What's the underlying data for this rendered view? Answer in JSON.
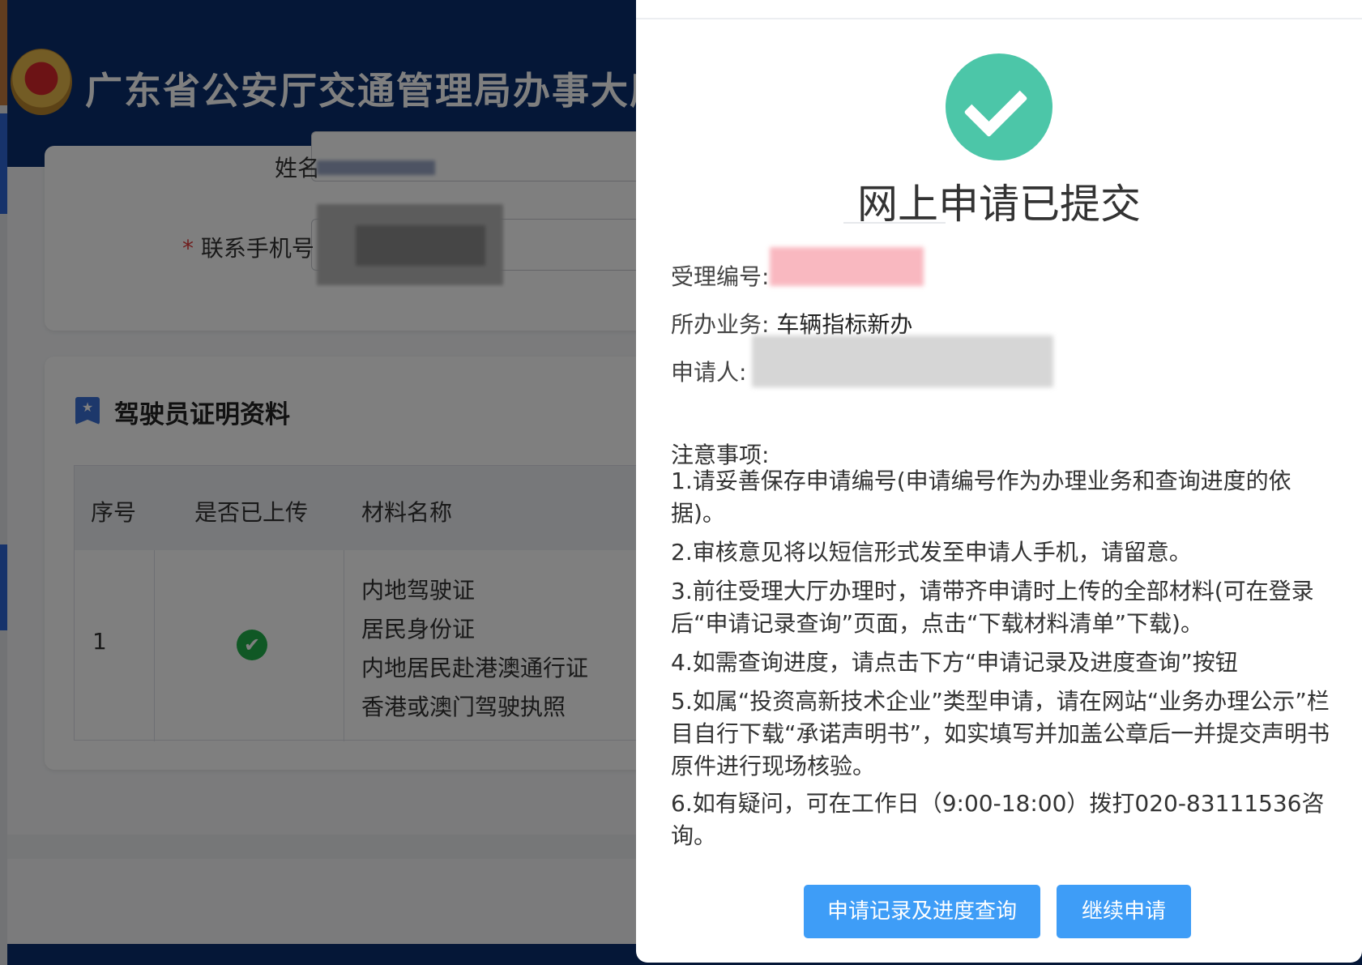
{
  "header": {
    "site_title": "广东省公安厅交通管理局办事大厅"
  },
  "form": {
    "name_label": "姓名",
    "phone_label": "联系手机号",
    "required_mark": "*"
  },
  "driver_section": {
    "title": "驾驶员证明资料",
    "columns": [
      "序号",
      "是否已上传",
      "材料名称"
    ],
    "rows": [
      {
        "no": "1",
        "uploaded": "✔",
        "materials": [
          "内地驾驶证",
          "居民身份证",
          "内地居民赴港澳通行证",
          "香港或澳门驾驶执照"
        ]
      }
    ]
  },
  "dialog": {
    "title": "网上申请已提交",
    "fields": {
      "acceptance_no_label": "受理编号:",
      "business_label": "所办业务:",
      "business_value": "车辆指标新办",
      "applicant_label": "申请人:"
    },
    "notes_title": "注意事项:",
    "notes": [
      "1.请妥善保存申请编号(申请编号作为办理业务和查询进度的依据)。",
      "2.审核意见将以短信形式发至申请人手机，请留意。",
      "3.前往受理大厅办理时，请带齐申请时上传的全部材料(可在登录后“申请记录查询”页面，点击“下载材料清单”下载)。",
      "4.如需查询进度，请点击下方“申请记录及进度查询”按钮",
      "5.如属“投资高新技术企业”类型申请，请在网站“业务办理公示”栏目自行下载“承诺声明书”，如实填写并加盖公章后一并提交声明书原件进行现场核验。",
      "6.如有疑问，可在工作日（9:00-18:00）拨打020-83111536咨询。"
    ],
    "buttons": {
      "query": "申请记录及进度查询",
      "continue": "继续申请"
    },
    "success_icon": "check-circle-icon",
    "colors": {
      "success": "#4cc6a8",
      "button": "#3e9df7"
    }
  }
}
